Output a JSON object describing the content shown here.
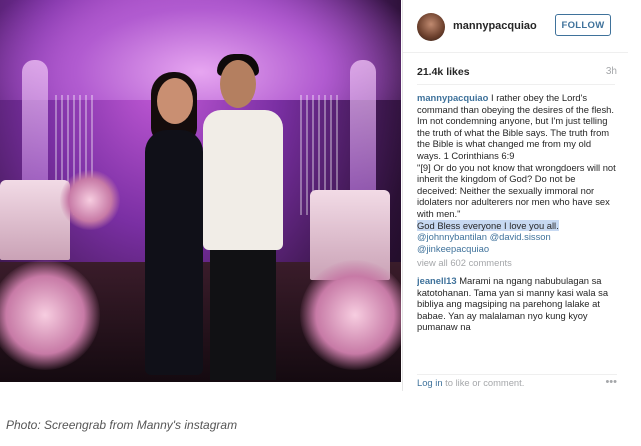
{
  "post": {
    "username": "mannypacquiao",
    "follow_label": "FOLLOW",
    "likes": "21.4k likes",
    "time": "3h",
    "caption_user": "mannypacquiao",
    "caption_text": "I rather obey the Lord's command than obeying the desires of the flesh. Im not condemning anyone, but I'm just telling the truth of what the Bible says. The truth from the Bible is what changed me from my old ways. 1 Corinthians 6:9",
    "verse": "\"[9] Or do you not know that wrongdoers will not inherit the kingdom of God? Do not be deceived: Neither the sexually immoral nor idolaters nor adulterers nor men who have sex with men.\"",
    "blessing": "God Bless everyone I love you all.",
    "mention1": "@johnnybantilan",
    "mention2": "@david.sisson",
    "mention3": "@jinkeepacquiao",
    "view_all": "view all 602 comments",
    "comment_user": "jeanell13",
    "comment_text": "Marami na ngang nabubulagan sa katotohanan. Tama yan si manny kasi wala sa bibliya ang magsiping na parehong lalake at babae. Yan ay malalaman nyo kung kyoy pumanaw na",
    "login_link": "Log in",
    "login_rest": "to like or comment.",
    "more_icon": "more-dots-icon"
  },
  "credit": "Photo: Screengrab from Manny's instagram"
}
